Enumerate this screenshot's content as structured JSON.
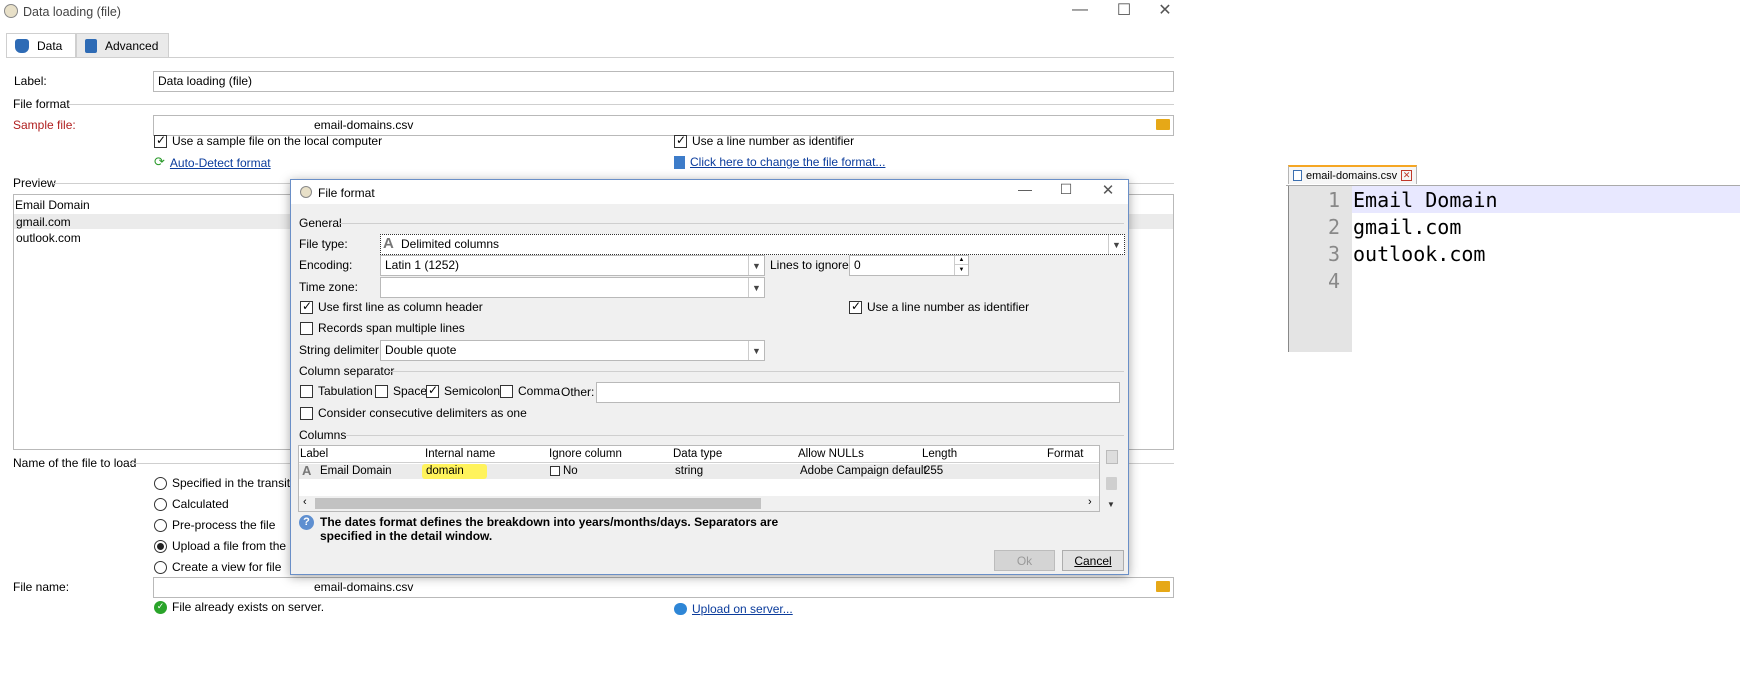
{
  "main_window": {
    "title": "Data loading (file)",
    "tabs": [
      {
        "label": "Data"
      },
      {
        "label": "Advanced"
      }
    ],
    "label_caption": "Label:",
    "label_value": "Data loading (file)",
    "file_format_section": "File format",
    "sample_file_caption": "Sample file:",
    "sample_file_value": "email-domains.csv",
    "use_sample_local": "Use a sample file on the local computer",
    "use_line_number": "Use a line number as identifier",
    "auto_detect": "Auto-Detect format",
    "change_format": "Click here to change the file format...",
    "preview_section": "Preview",
    "preview_header": "Email Domain",
    "preview_rows": [
      "gmail.com",
      "outlook.com"
    ],
    "name_section": "Name of the file to load",
    "name_options": [
      {
        "label": "Specified in the transition",
        "checked": false
      },
      {
        "label": "Calculated",
        "checked": false
      },
      {
        "label": "Pre-process the file",
        "checked": false
      },
      {
        "label": "Upload a file from the loc",
        "checked": true
      },
      {
        "label": "Create a view for file",
        "checked": false
      }
    ],
    "file_name_caption": "File name:",
    "file_name_value": "email-domains.csv",
    "file_exists": "File already exists on server.",
    "upload_link": "Upload on server..."
  },
  "dialog": {
    "title": "File format",
    "general_section": "General",
    "file_type_caption": "File type:",
    "file_type_value": "Delimited columns",
    "encoding_caption": "Encoding:",
    "encoding_value": "Latin 1 (1252)",
    "lines_ignore_caption": "Lines to ignore:",
    "lines_ignore_value": "0",
    "time_zone_caption": "Time zone:",
    "time_zone_value": "",
    "first_line_header": "Use first line as column header",
    "line_number_identifier": "Use a line number as identifier",
    "records_span": "Records span multiple lines",
    "string_delim_caption": "String delimiter:",
    "string_delim_value": "Double quote",
    "column_sep_section": "Column separator",
    "separators": [
      {
        "label": "Tabulation",
        "checked": false
      },
      {
        "label": "Space",
        "checked": false
      },
      {
        "label": "Semicolon",
        "checked": true
      },
      {
        "label": "Comma",
        "checked": false
      }
    ],
    "other_caption": "Other:",
    "other_value": "",
    "consecutive": "Consider consecutive delimiters as one",
    "columns_section": "Columns",
    "columns_headers": [
      "Label",
      "Internal name",
      "Ignore column",
      "Data type",
      "Allow NULLs",
      "Length",
      "Format"
    ],
    "columns_row": {
      "label": "Email Domain",
      "internal_name": "domain",
      "ignore": "No",
      "data_type": "string",
      "allow_nulls": "Adobe Campaign default",
      "length": "255",
      "format": ""
    },
    "info_text_line1": "The dates format defines the breakdown into years/months/days. Separators are",
    "info_text_line2": "specified in the detail window.",
    "ok_label": "Ok",
    "cancel_label": "Cancel"
  },
  "editor": {
    "tab_label": "email-domains.csv",
    "line_numbers": [
      "1",
      "2",
      "3",
      "4"
    ],
    "lines": [
      "Email Domain",
      "gmail.com",
      "outlook.com",
      ""
    ]
  },
  "colors": {
    "highlight": "#fff35c",
    "link": "#0b3c9c",
    "required_label": "#b01e1e",
    "dialog_border": "#6a8fc7"
  }
}
